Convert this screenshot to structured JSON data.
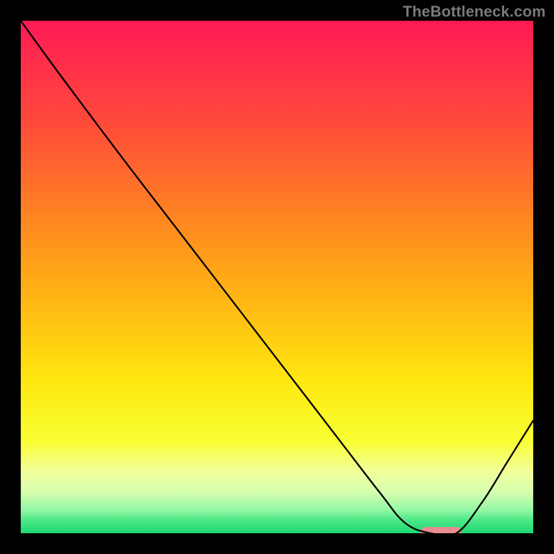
{
  "watermark": "TheBottleneck.com",
  "chart_data": {
    "type": "line",
    "title": "",
    "xlabel": "",
    "ylabel": "",
    "xlim": [
      0,
      100
    ],
    "ylim": [
      0,
      100
    ],
    "grid": false,
    "legend": false,
    "series": [
      {
        "name": "bottleneck-curve",
        "x": [
          0,
          8,
          20,
          30,
          40,
          50,
          60,
          70,
          75,
          80,
          85,
          90,
          95,
          100
        ],
        "values": [
          100,
          89,
          73,
          60,
          47,
          34,
          21,
          8,
          2,
          0,
          0,
          6,
          14,
          22
        ]
      }
    ],
    "marker": {
      "name": "optimal-range",
      "x_center": 82,
      "y": 0,
      "width": 8,
      "color": "#e98d8f"
    },
    "gradient_stops": [
      {
        "offset": 0,
        "color": "#ff1a56"
      },
      {
        "offset": 0.2,
        "color": "#ff4a3a"
      },
      {
        "offset": 0.4,
        "color": "#ff8a1f"
      },
      {
        "offset": 0.55,
        "color": "#ffb814"
      },
      {
        "offset": 0.7,
        "color": "#ffe70f"
      },
      {
        "offset": 0.82,
        "color": "#f9ff33"
      },
      {
        "offset": 0.88,
        "color": "#f1ff9a"
      },
      {
        "offset": 0.92,
        "color": "#d6ffb0"
      },
      {
        "offset": 0.955,
        "color": "#93f7a4"
      },
      {
        "offset": 0.975,
        "color": "#4be886"
      },
      {
        "offset": 1.0,
        "color": "#1fd873"
      }
    ]
  }
}
